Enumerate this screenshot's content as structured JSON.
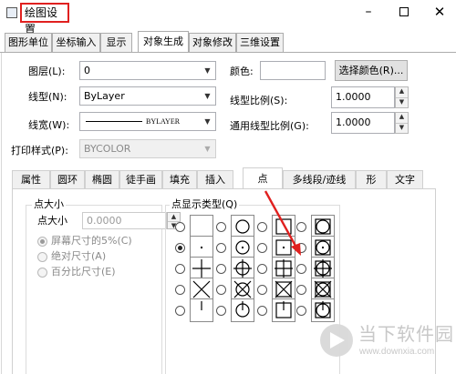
{
  "window": {
    "title": "绘图设置",
    "minimize": "–",
    "close": "✕"
  },
  "tabs": [
    "图形单位",
    "坐标输入",
    "显示",
    "对象生成",
    "对象修改",
    "三维设置"
  ],
  "object_gen": {
    "layer": {
      "label": "图层(L):",
      "value": "0"
    },
    "linetype": {
      "label": "线型(N):",
      "value": "ByLayer"
    },
    "lineweight": {
      "label": "线宽(W):",
      "value": "BYLAYER"
    },
    "plotstyle": {
      "label": "打印样式(P):",
      "value": "BYCOLOR"
    },
    "color": {
      "label": "颜色:",
      "value": "",
      "button": "选择颜色(R)..."
    },
    "linetype_scale": {
      "label": "线型比例(S):",
      "value": "1.0000"
    },
    "global_linetype_scale": {
      "label": "通用线型比例(G):",
      "value": "1.0000"
    }
  },
  "subtabs": [
    "属性",
    "圆环",
    "椭圆",
    "徒手画",
    "填充",
    "插入",
    "点",
    "多线段/迹线",
    "形",
    "文字"
  ],
  "point": {
    "size_group": "点大小",
    "size_label": "点大小",
    "size_value": "0.0000",
    "options": [
      "屏幕尺寸的5%(C)",
      "绝对尺寸(A)",
      "百分比尺寸(E)"
    ],
    "type_group": "点显示类型(Q)",
    "selected_mode": "dot",
    "highlighted_mode": "circle-square-cross"
  },
  "watermark": {
    "name": "当下软件园",
    "url": "www.downxia.com"
  },
  "colors": {
    "highlight": "#e0201f",
    "tab_bg": "#f0f0f0",
    "border": "#acacac"
  },
  "icons": [
    "app-icon",
    "close-icon",
    "dropdown-arrow-icon",
    "spin-up-icon",
    "spin-down-icon",
    "watermark-logo-icon"
  ]
}
